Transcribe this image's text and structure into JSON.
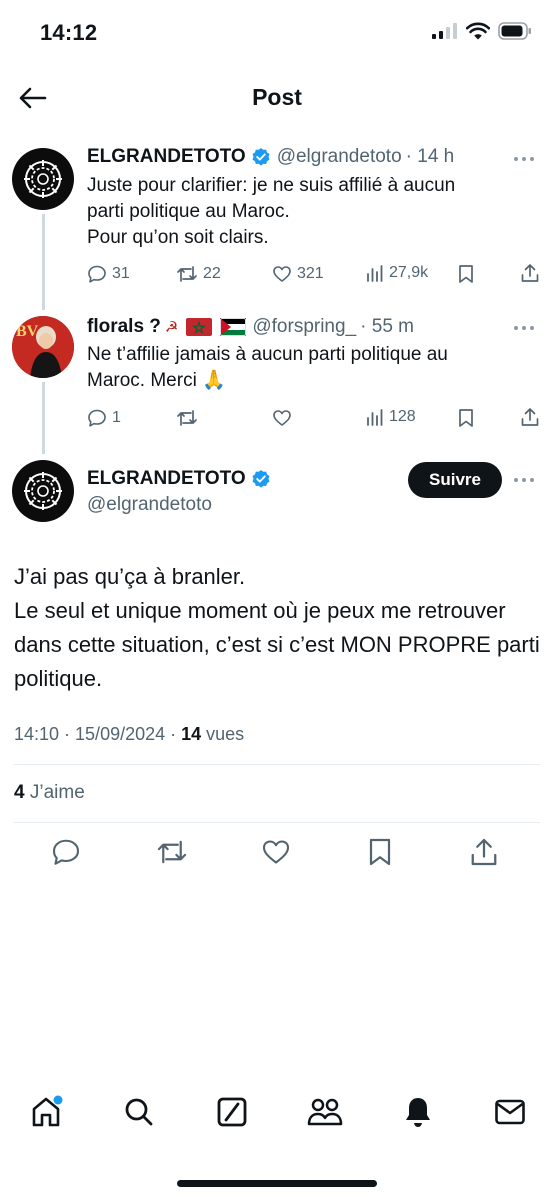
{
  "status_bar": {
    "time": "14:12"
  },
  "header": {
    "title": "Post"
  },
  "tweets": [
    {
      "name": "ELGRANDETOTO",
      "handle": "@elgrandetoto",
      "time": "· 14 h",
      "lines": [
        "Juste pour clarifier: je ne suis affilié à aucun",
        "parti politique au Maroc.",
        "Pour qu’on soit clairs."
      ],
      "replies": "31",
      "retweets": "22",
      "likes": "321",
      "views": "27,9k"
    },
    {
      "name": "florals ?",
      "emoji": "☭",
      "handle": "@forspring_",
      "time": "· 55 m",
      "lines": [
        "Ne t’affilie jamais à aucun parti politique au",
        "Maroc. Merci 🙏"
      ],
      "replies": "1",
      "retweets": "",
      "likes": "",
      "views": "128"
    }
  ],
  "main_post": {
    "name": "ELGRANDETOTO",
    "handle": "@elgrandetoto",
    "follow_label": "Suivre",
    "paragraph_1": "J’ai pas qu’ça à branler.",
    "paragraph_2": "Le seul et unique moment où je peux me retrouver dans cette situation, c’est si c’est MON PROPRE parti politique.",
    "timestamp": "14:10 · 15/09/2024 · ",
    "views_count": "14",
    "views_label": " vues",
    "likes_count": "4",
    "likes_label": " J’aime"
  },
  "tab_bar": {
    "items": [
      "home-icon",
      "search-icon",
      "grok-icon",
      "communities-icon",
      "notifications-icon",
      "messages-icon"
    ]
  },
  "colors": {
    "accent": "#1d9bf0",
    "text": "#0f1419",
    "muted": "#536471",
    "verified": "#1d9bf0"
  }
}
